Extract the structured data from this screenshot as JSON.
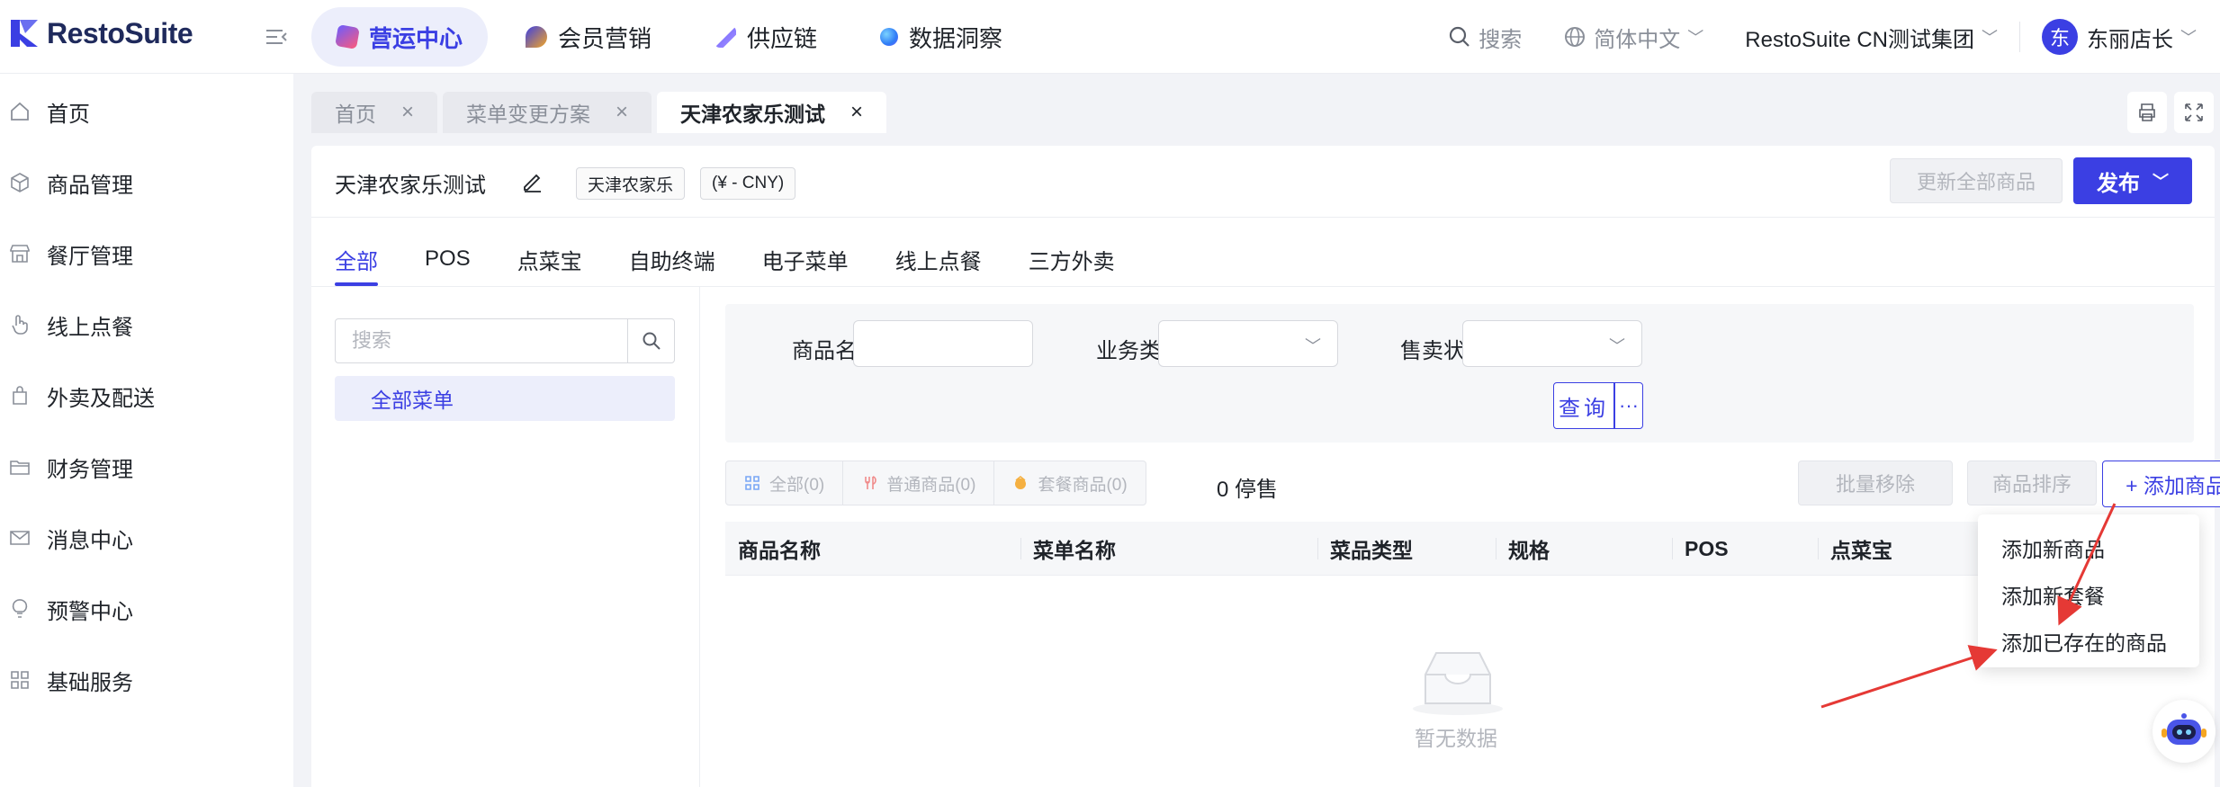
{
  "app": {
    "brand": "RestoSuite"
  },
  "topnav": {
    "items": [
      {
        "label": "营运中心",
        "active": true,
        "color": "#3b3fe3"
      },
      {
        "label": "会员营销",
        "color": "#f5a623"
      },
      {
        "label": "供应链",
        "color": "#6a5cff"
      },
      {
        "label": "数据洞察",
        "color": "#2f7cf6"
      }
    ],
    "search_label": "搜索",
    "language": "简体中文",
    "org": "RestoSuite CN测试集团",
    "avatar_char": "东",
    "user": "东丽店长"
  },
  "sidebar": {
    "items": [
      {
        "label": "首页",
        "icon": "home-icon"
      },
      {
        "label": "商品管理",
        "icon": "box-icon"
      },
      {
        "label": "餐厅管理",
        "icon": "store-icon"
      },
      {
        "label": "线上点餐",
        "icon": "hand-icon"
      },
      {
        "label": "外卖及配送",
        "icon": "bag-icon"
      },
      {
        "label": "财务管理",
        "icon": "folder-icon"
      },
      {
        "label": "消息中心",
        "icon": "mail-icon"
      },
      {
        "label": "预警中心",
        "icon": "bulb-icon"
      },
      {
        "label": "基础服务",
        "icon": "grid-icon"
      }
    ]
  },
  "tabs": [
    {
      "label": "首页",
      "active": false
    },
    {
      "label": "菜单变更方案",
      "active": false
    },
    {
      "label": "天津农家乐测试",
      "active": true
    }
  ],
  "header": {
    "title": "天津农家乐测试",
    "tag1": "天津农家乐",
    "tag2": "(¥ - CNY)",
    "update_all": "更新全部商品",
    "publish": "发布"
  },
  "subtabs": [
    "全部",
    "POS",
    "点菜宝",
    "自助终端",
    "电子菜单",
    "线上点餐",
    "三方外卖"
  ],
  "leftpane": {
    "search_placeholder": "搜索",
    "menu_all": "全部菜单"
  },
  "filter": {
    "name_label": "商品名称",
    "biz_label": "业务类型",
    "sale_label": "售卖状态",
    "query": "查询",
    "more": "···"
  },
  "segment": [
    {
      "label": "全部(0)",
      "color": "#7aa7f5"
    },
    {
      "label": "普通商品(0)",
      "color": "#f08a8a"
    },
    {
      "label": "套餐商品(0)",
      "color": "#f5b041"
    }
  ],
  "stopped": "0 停售",
  "actions": {
    "batch_remove": "批量移除",
    "sort": "商品排序",
    "add": "+ 添加商品"
  },
  "table": {
    "columns": [
      "商品名称",
      "菜单名称",
      "菜品类型",
      "规格",
      "POS",
      "点菜宝"
    ],
    "empty": "暂无数据"
  },
  "dropdown": [
    "添加新商品",
    "添加新套餐",
    "添加已存在的商品"
  ],
  "colors": {
    "accent": "#3b3fe3",
    "annotation": "#e53935"
  }
}
